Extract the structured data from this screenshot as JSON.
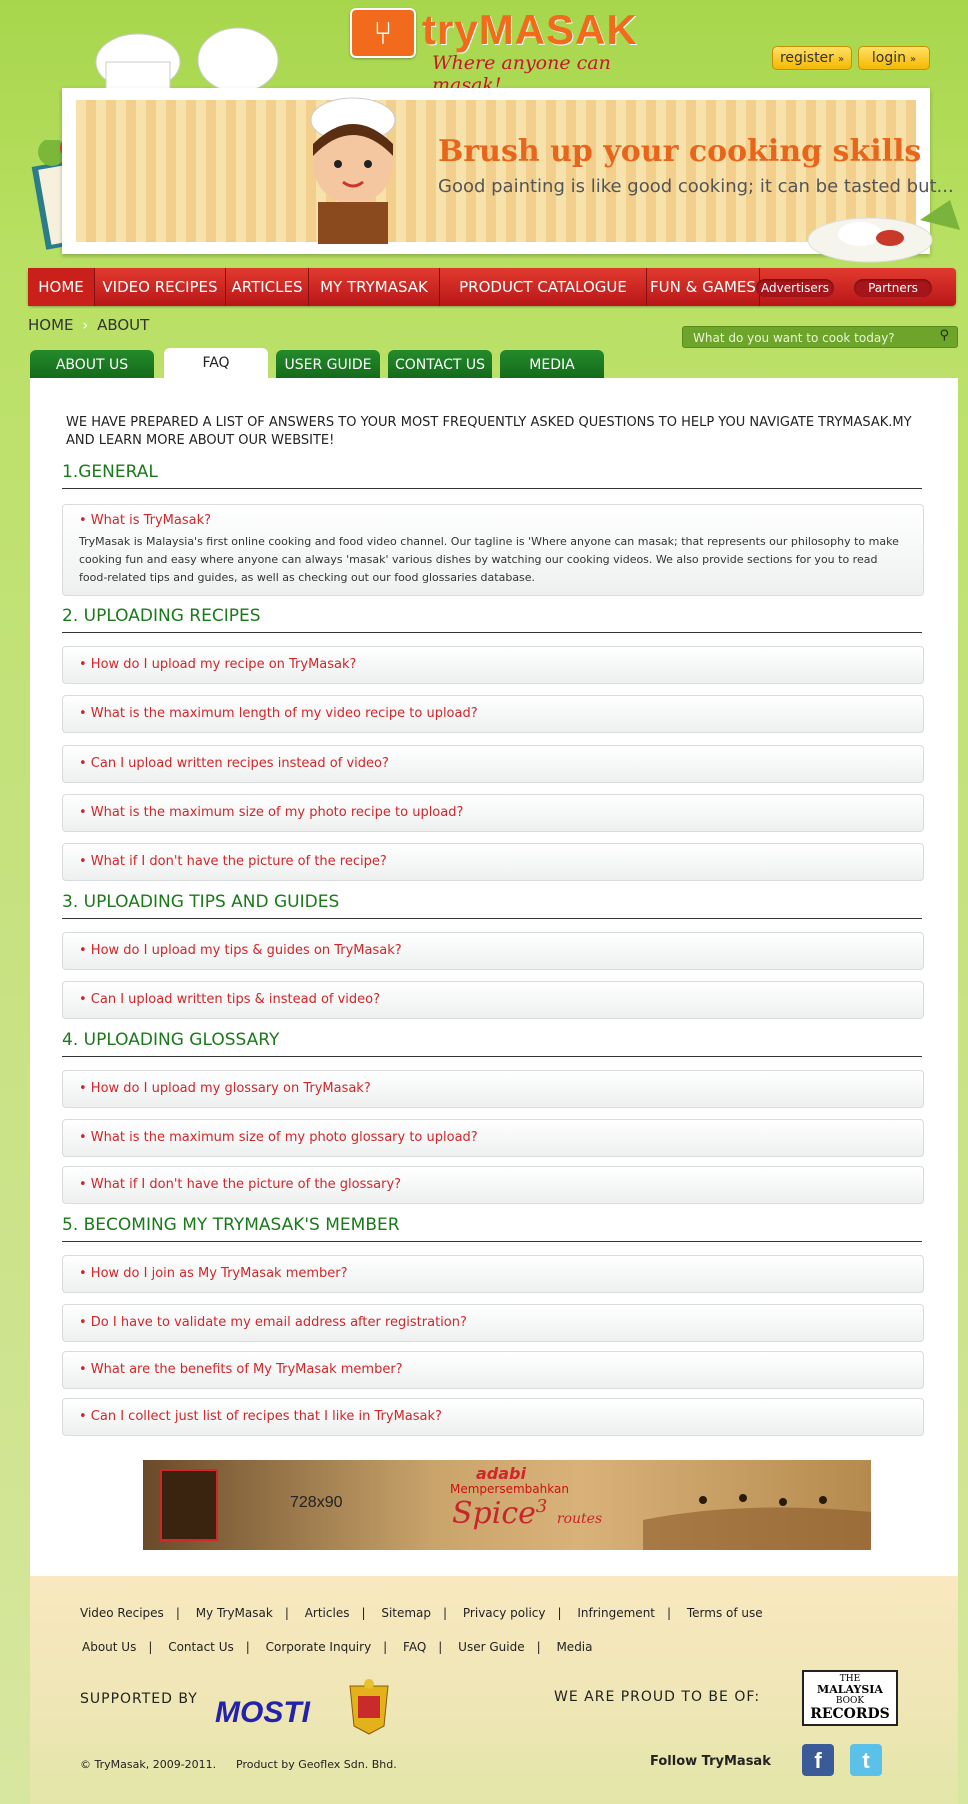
{
  "header": {
    "logo_text": "tryMASAK",
    "logo_tagline": "Where anyone can masak!",
    "register_label": "register",
    "login_label": "login"
  },
  "banner": {
    "title": "Brush up your cooking skills",
    "subtitle": "Good painting is like good cooking; it can be tasted but..."
  },
  "nav": {
    "items": [
      "HOME",
      "VIDEO RECIPES",
      "ARTICLES",
      "MY TRYMASAK",
      "PRODUCT CATALOGUE",
      "FUN & GAMES"
    ],
    "pills": [
      "Advertisers",
      "Partners"
    ]
  },
  "breadcrumb": {
    "home": "HOME",
    "current": "ABOUT"
  },
  "search": {
    "placeholder": "What do you want to cook today?"
  },
  "tabs": [
    "ABOUT US",
    "FAQ",
    "USER GUIDE",
    "CONTACT US",
    "MEDIA"
  ],
  "intro": "We have prepared a list of answers to your most frequently asked questions to help you navigate TryMasak.my and learn more about our website!",
  "sections": [
    {
      "title": "1.GENERAL",
      "items": [
        {
          "q": "• What is TryMasak?",
          "a": "TryMasak is Malaysia's first online cooking and food video channel. Our tagline is 'Where anyone can masak; that represents our philosophy to make cooking fun and easy where anyone can always 'masak' various dishes by watching our cooking videos. We also provide sections for you to read food-related tips and guides, as well as checking out our food glossaries database."
        }
      ]
    },
    {
      "title": "2. UPLOADING RECIPES",
      "items": [
        {
          "q": "• How do I upload my recipe on TryMasak?"
        },
        {
          "q": "• What is the maximum length of my video recipe to upload?"
        },
        {
          "q": "• Can I upload written recipes instead of video?"
        },
        {
          "q": "• What is the maximum size of my photo recipe to upload?"
        },
        {
          "q": "• What if I don't have the picture of the recipe?"
        }
      ]
    },
    {
      "title": "3. UPLOADING TIPS AND GUIDES",
      "items": [
        {
          "q": "• How do I upload my tips & guides on TryMasak?"
        },
        {
          "q": "• Can I upload written tips & instead of video?"
        }
      ]
    },
    {
      "title": "4. UPLOADING GLOSSARY",
      "items": [
        {
          "q": "• How do I upload my glossary on TryMasak?"
        },
        {
          "q": "• What is the maximum size of my photo glossary to upload?"
        },
        {
          "q": "• What if I don't have the picture of the glossary?"
        }
      ]
    },
    {
      "title": "5. BECOMING MY TRYMASAK'S MEMBER",
      "items": [
        {
          "q": "• How do I join as My TryMasak member?"
        },
        {
          "q": "• Do I have to validate my email address after registration?"
        },
        {
          "q": "• What are the benefits of My TryMasak member?"
        },
        {
          "q": "• Can I collect just list of recipes that I like in TryMasak?"
        }
      ]
    }
  ],
  "ad": {
    "size": "728x90",
    "brand": "adabi",
    "sub": "Mempersembahkan",
    "headline": "Spice",
    "number": "3",
    "tail": "routes"
  },
  "footer": {
    "links_row1": [
      "Video Recipes",
      "My TryMasak",
      "Articles",
      "Sitemap",
      "Privacy policy",
      "Infringement",
      "Terms of use"
    ],
    "links_row2": [
      "About Us",
      "Contact Us",
      "Corporate Inquiry",
      "FAQ",
      "User Guide",
      "Media"
    ],
    "supported_by": "SUPPORTED BY",
    "mosti": "MOSTI",
    "proud": "WE ARE PROUD TO BE OF:",
    "records_line1": "THE",
    "records_line2": "MALAYSIA",
    "records_line3": "BOOK",
    "records_line4": "RECORDS",
    "copyright": "© TryMasak, 2009-2011.",
    "product_by": "Product by Geoflex Sdn. Bhd.",
    "follow": "Follow TryMasak"
  },
  "colors": {
    "brand_orange": "#f26b1d",
    "nav_red": "#c9201b",
    "tab_green": "#1f7e25",
    "question_red": "#d1262a",
    "section_green": "#1a7a1a"
  }
}
